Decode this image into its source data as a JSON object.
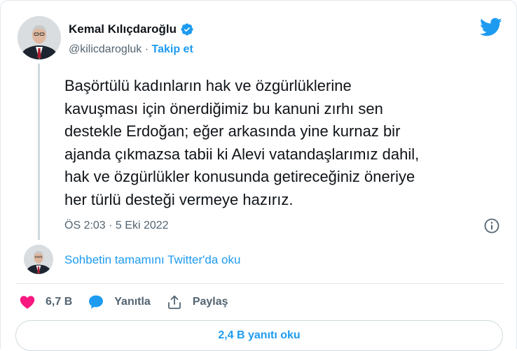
{
  "author": {
    "name": "Kemal Kılıçdaroğlu",
    "handle": "@kilicdarogluk",
    "separator": " · ",
    "follow_label": "Takip et"
  },
  "tweet": {
    "text": "Başörtülü kadınların hak ve özgürlüklerine\nkavuşması için önerdiğimiz bu kanuni zırhı sen\ndestekle Erdoğan; eğer arkasında yine kurnaz bir\najanda çıkmazsa tabii ki Alevi vatandaşlarımız dahil,\nhak ve özgürlükler konusunda getireceğiniz öneriye\nher türlü desteği vermeye hazırız.",
    "timestamp": "ÖS 2:03 · 5 Eki 2022"
  },
  "thread": {
    "read_more_label": "Sohbetin tamamını Twitter'da oku"
  },
  "actions": {
    "like_count": "6,7 B",
    "reply_label": "Yanıtla",
    "share_label": "Paylaş"
  },
  "replies_button": {
    "label": "2,4 B yanıtı oku"
  },
  "icons": {
    "brand": "twitter-bird-icon",
    "verified": "verified-badge-icon",
    "info": "info-icon",
    "like": "heart-icon",
    "reply": "speech-bubble-icon",
    "share": "share-icon"
  },
  "colors": {
    "accent": "#1d9bf0",
    "like": "#f91880",
    "text": "#0f1419",
    "muted": "#536471",
    "border": "#e1e8ed"
  }
}
